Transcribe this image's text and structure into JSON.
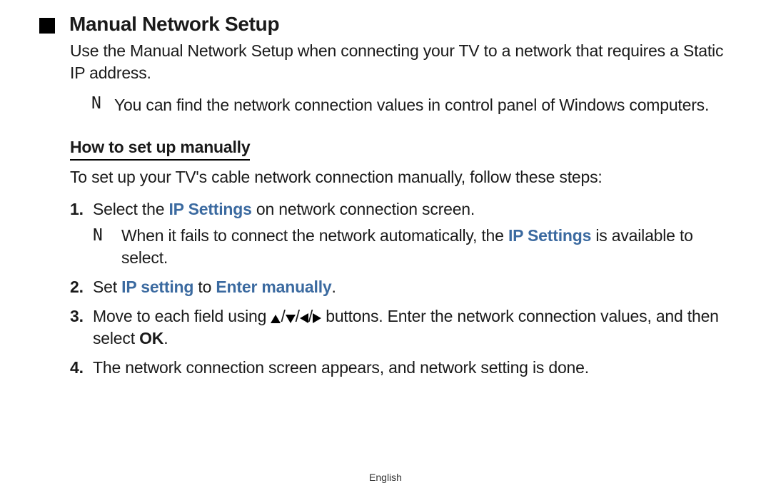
{
  "title": "Manual Network Setup",
  "intro": "Use the Manual Network Setup when connecting your TV to a network that requires a Static IP address.",
  "note_marker": "N",
  "top_note": "You can find the network connection values in control panel of Windows computers.",
  "subhead": "How to set up manually",
  "lead": "To set up your TV's cable network connection manually, follow these steps:",
  "steps": {
    "1": {
      "num": "1.",
      "pre": "Select the ",
      "hl": "IP Settings",
      "post": " on network connection screen.",
      "note_pre": "When it fails to connect the network automatically, the ",
      "note_hl": "IP Settings",
      "note_post": " is available to select."
    },
    "2": {
      "num": "2.",
      "pre": "Set ",
      "hl1": "IP setting",
      "mid": " to ",
      "hl2": "Enter manually",
      "post": "."
    },
    "3": {
      "num": "3.",
      "pre": "Move to each field using ",
      "post": " buttons. Enter the network connection values, and then select ",
      "ok": "OK",
      "end": "."
    },
    "4": {
      "num": "4.",
      "text": "The network connection screen appears, and network setting is done."
    }
  },
  "slash": "/",
  "footer": "English"
}
